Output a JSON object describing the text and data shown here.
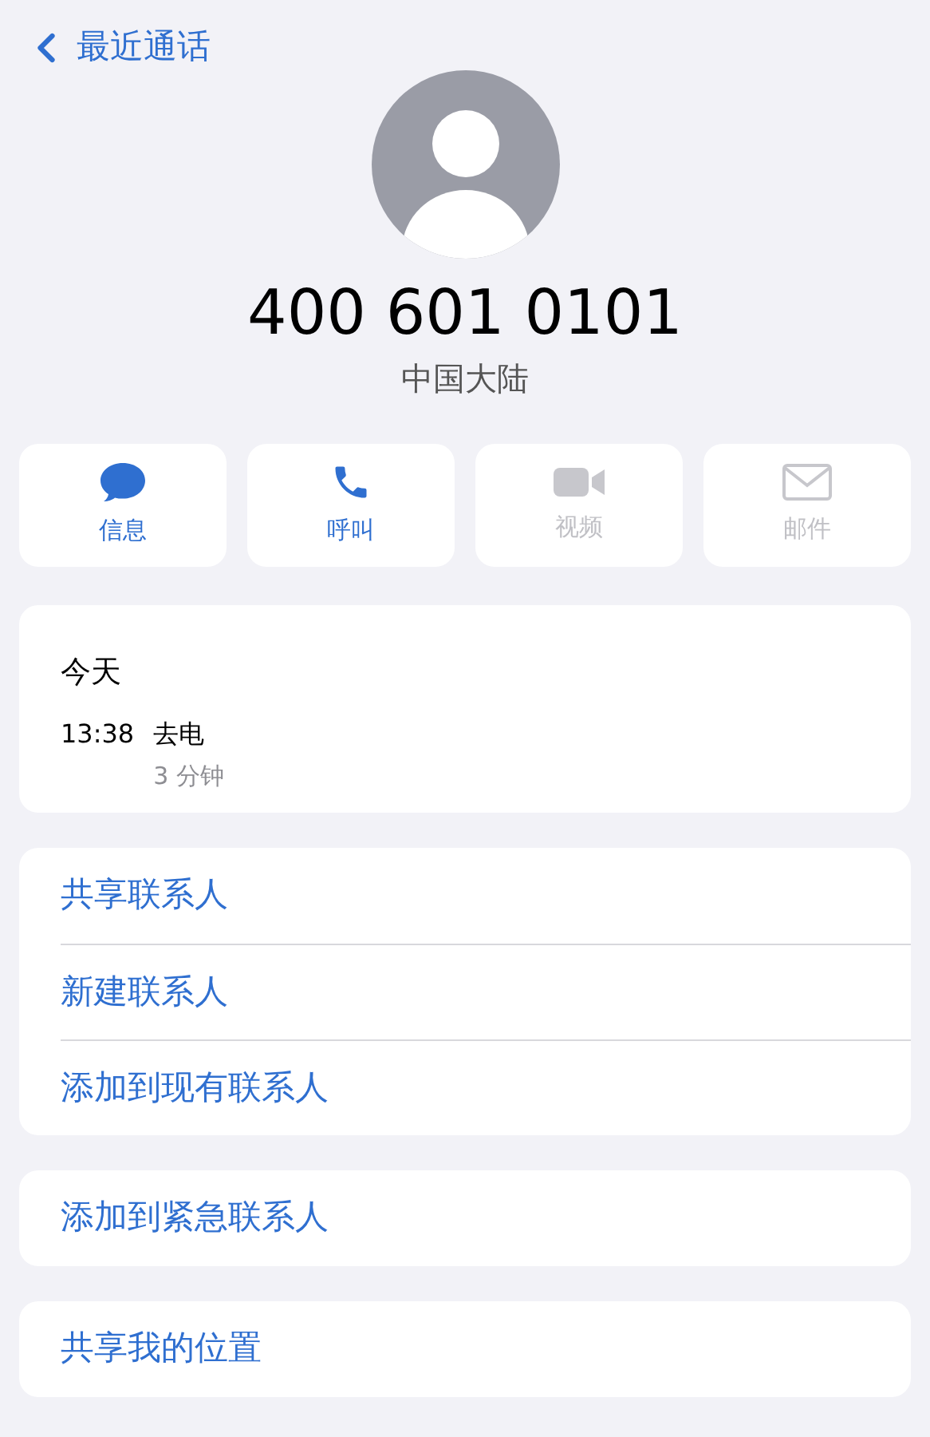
{
  "back": {
    "label": "最近通话"
  },
  "contact": {
    "number": "400 601 0101",
    "region": "中国大陆"
  },
  "actions": [
    {
      "kind": "message",
      "label": "信息",
      "disabled": false
    },
    {
      "kind": "call",
      "label": "呼叫",
      "disabled": false
    },
    {
      "kind": "video",
      "label": "视频",
      "disabled": true
    },
    {
      "kind": "mail",
      "label": "邮件",
      "disabled": true
    }
  ],
  "recents": {
    "title": "今天",
    "entries": [
      {
        "time": "13:38",
        "type": "去电",
        "duration": "3 分钟"
      }
    ]
  },
  "groups": [
    [
      "共享联系人",
      "新建联系人",
      "添加到现有联系人"
    ],
    [
      "添加到紧急联系人"
    ],
    [
      "共享我的位置"
    ]
  ]
}
